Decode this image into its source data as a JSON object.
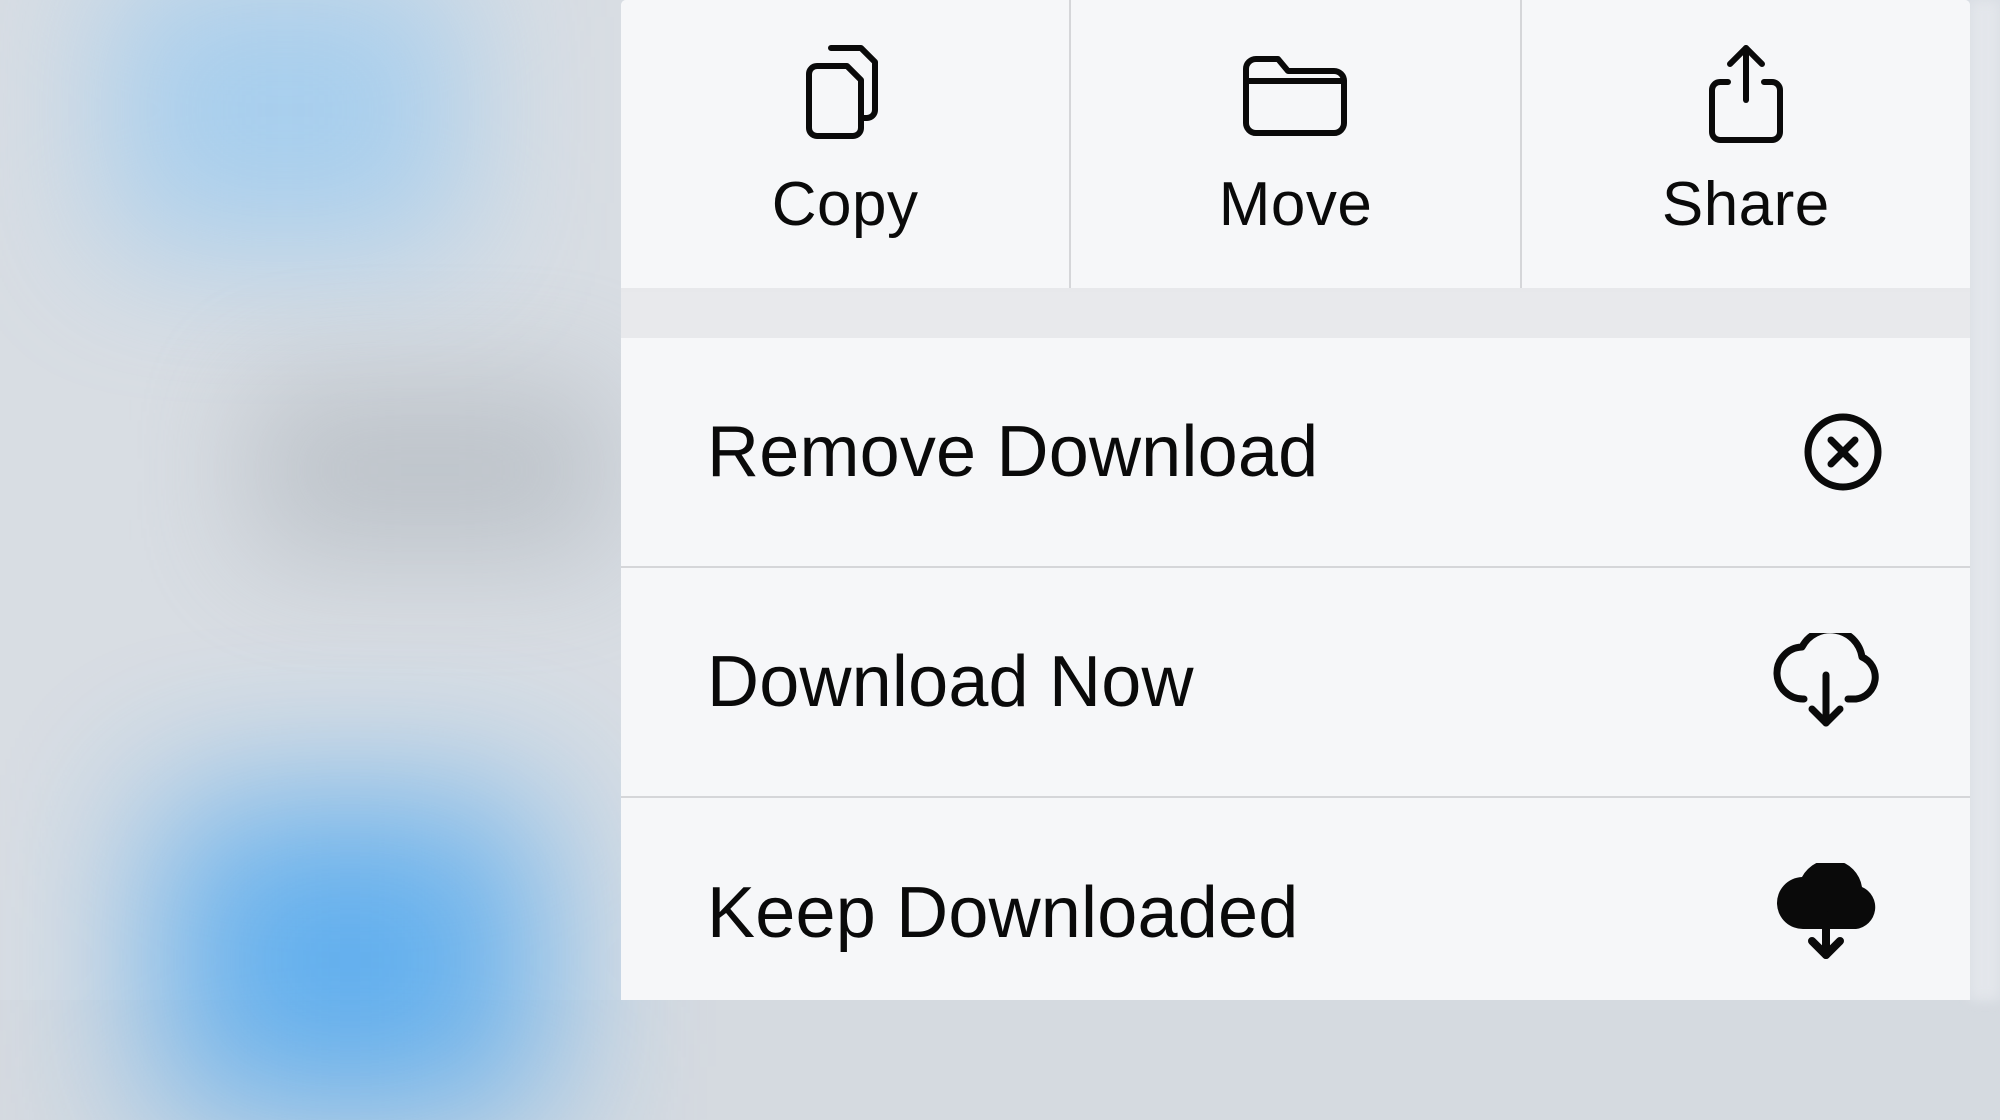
{
  "actions": {
    "copy": {
      "label": "Copy",
      "icon": "copy-icon"
    },
    "move": {
      "label": "Move",
      "icon": "folder-icon"
    },
    "share": {
      "label": "Share",
      "icon": "share-icon"
    }
  },
  "menu": {
    "remove_download": {
      "label": "Remove Download",
      "icon": "circle-x-icon"
    },
    "download_now": {
      "label": "Download Now",
      "icon": "cloud-download-outline-icon"
    },
    "keep_downloaded": {
      "label": "Keep Downloaded",
      "icon": "cloud-download-filled-icon"
    }
  }
}
